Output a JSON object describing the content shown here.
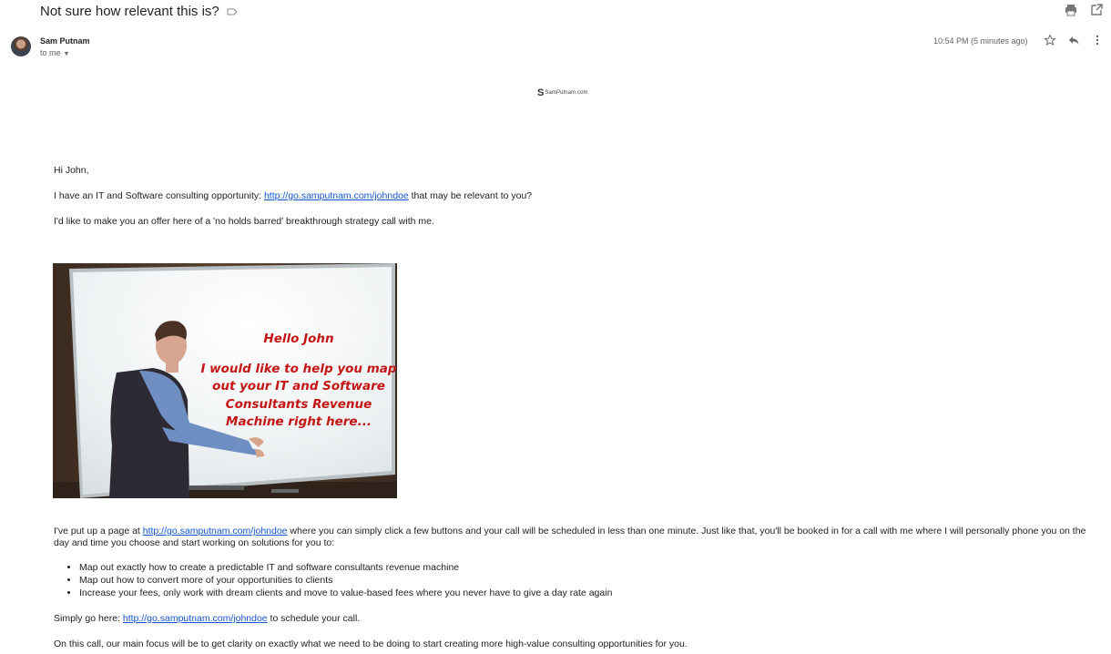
{
  "email": {
    "subject": "Not sure how relevant this is?",
    "sender_name": "Sam Putnam",
    "recipient": "to me",
    "timestamp": "10:54 PM (5 minutes ago)"
  },
  "icons": {
    "label": "label-outline-icon",
    "print": "print-icon",
    "open_new_window": "open-in-new-window-icon",
    "star": "star-icon",
    "reply": "reply-icon",
    "more": "more-vertical-icon"
  },
  "logo": {
    "mark": "S",
    "text": "SamPutnam.com"
  },
  "body": {
    "greeting": "Hi John,",
    "p1_before": "I have an IT and Software consulting opportunity: ",
    "link": "http://go.samputnam.com/johndoe",
    "p1_after": " that may be relevant to you?",
    "p2": "I'd like to make you an offer here of a 'no holds barred' breakthrough strategy call with me.",
    "p3_before": "I've put up a page at ",
    "p3_after": " where you can simply click a few buttons and your call will be scheduled in less than one minute. Just like that, you'll be booked in for a call with me where I will personally phone you on the day and time you choose and start working on solutions for you to:",
    "bullets": [
      "Map out exactly how to create a predictable IT and software consultants revenue machine",
      "Map out how to convert more of your opportunities to clients",
      "Increase your fees, only work with dream clients and move to value-based fees where you never have to give a day rate again"
    ],
    "p4_before": "Simply go here: ",
    "p4_after": " to schedule your call.",
    "p5": "On this call, our main focus will be to get clarity on exactly what we need to be doing to start creating more high-value consulting opportunities for you."
  },
  "image": {
    "hello": "Hello John",
    "lines": [
      "I would like to help you map",
      "out your IT and Software",
      "Consultants Revenue",
      "Machine right here..."
    ]
  },
  "colors": {
    "link": "#1155cc",
    "image_text": "#c41515",
    "meta_grey": "#5f6368"
  }
}
